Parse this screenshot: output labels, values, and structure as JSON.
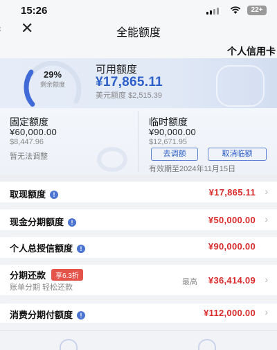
{
  "status_bar": {
    "time": "15:26",
    "battery": "22+"
  },
  "nav": {
    "title": "全能额度",
    "close_icon": "close-icon"
  },
  "card_tab": {
    "label": "个人信用卡"
  },
  "hero": {
    "remaining_percent": "29%",
    "remaining_fraction": 0.29,
    "remaining_label": "剩余额度",
    "available_label": "可用额度",
    "available_value": "¥17,865.11",
    "usd_label": "美元额度",
    "usd_value": "$2,515.39"
  },
  "fixed": {
    "label": "固定额度",
    "value": "¥60,000.00",
    "usd": "$8,447.96",
    "note": "暂无法调整"
  },
  "temporary": {
    "label": "临时额度",
    "value": "¥90,000.00",
    "usd": "$12,671.95",
    "buttons": [
      "去调额",
      "取消临额"
    ],
    "validity": "有效期至2024年11月15日"
  },
  "rows": [
    {
      "label": "取现额度",
      "info": true,
      "value": "¥17,865.11"
    },
    {
      "label": "现金分期额度",
      "info": true,
      "value": "¥50,000.00"
    },
    {
      "label": "个人总授信额度",
      "info": true,
      "value": "¥90,000.00"
    },
    {
      "label": "分期还款",
      "promo": "享6.3折",
      "sub": "账单分期 轻松还款",
      "max_label": "最高",
      "value": "¥36,414.09"
    },
    {
      "label": "消费分期付额度",
      "info": true,
      "value": "¥112,000.00"
    }
  ],
  "colors": {
    "accent": "#2d5fc9",
    "amount": "#d92c2c",
    "promo": "#e5544a"
  }
}
